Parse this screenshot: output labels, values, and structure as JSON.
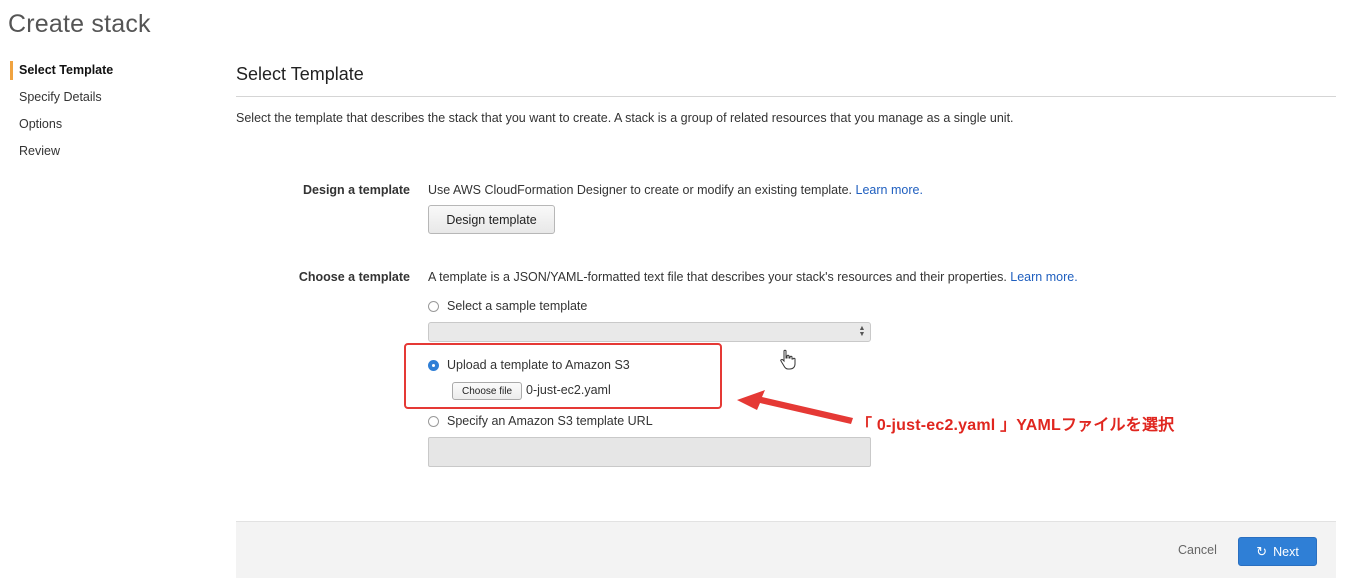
{
  "page": {
    "title": "Create stack"
  },
  "steps": [
    {
      "label": "Select Template",
      "active": true
    },
    {
      "label": "Specify Details",
      "active": false
    },
    {
      "label": "Options",
      "active": false
    },
    {
      "label": "Review",
      "active": false
    }
  ],
  "section": {
    "title": "Select Template",
    "description": "Select the template that describes the stack that you want to create. A stack is a group of related resources that you manage as a single unit."
  },
  "design": {
    "label": "Design a template",
    "text": "Use AWS CloudFormation Designer to create or modify an existing template.",
    "link": "Learn more.",
    "button": "Design template"
  },
  "choose": {
    "label": "Choose a template",
    "text": "A template is a JSON/YAML-formatted text file that describes your stack's resources and their properties.",
    "link": "Learn more.",
    "options": [
      {
        "label": "Select a sample template",
        "checked": false
      },
      {
        "label": "Upload a template to Amazon S3",
        "checked": true
      },
      {
        "label": "Specify an Amazon S3 template URL",
        "checked": false
      }
    ],
    "choose_file_button": "Choose file",
    "file_name": "0-just-ec2.yaml"
  },
  "annotation": {
    "text": "「 0-just-ec2.yaml 」YAMLファイルを選択",
    "color": "#e0261f"
  },
  "footer": {
    "cancel": "Cancel",
    "next": "Next"
  },
  "colors": {
    "accent": "#2f7fd6",
    "step_marker": "#f0a340",
    "link": "#1f5fbf",
    "highlight": "#e53935"
  }
}
